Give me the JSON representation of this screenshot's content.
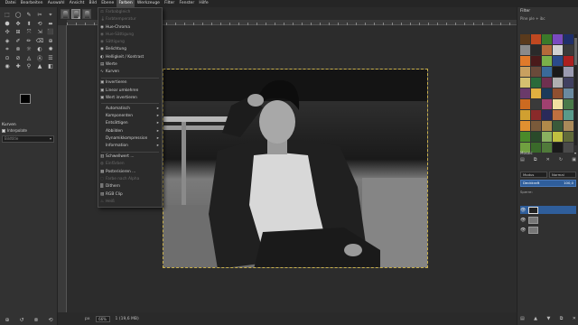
{
  "menubar": {
    "items": [
      "Datei",
      "Bearbeiten",
      "Auswahl",
      "Ansicht",
      "Bild",
      "Ebene",
      "Farben",
      "Werkzeuge",
      "Filter",
      "Fenster",
      "Hilfe"
    ],
    "active_index": 6
  },
  "tool_options": {
    "title": "Kurven",
    "checkbox_label": "Interpolate",
    "field_placeholder": "Bildtitle"
  },
  "colors_menu": {
    "items": [
      {
        "label": "Farbabgleich",
        "enabled": false,
        "icon": "balance-icon"
      },
      {
        "label": "Farbtemperatur",
        "enabled": false,
        "icon": "thermometer-icon"
      },
      {
        "label": "Hue-Chroma",
        "enabled": true,
        "icon": "circle-icon"
      },
      {
        "label": "Hue-Sättigung",
        "enabled": false,
        "icon": "circle-icon"
      },
      {
        "label": "Sättigung",
        "enabled": false,
        "icon": "circle-icon"
      },
      {
        "label": "Belichtung",
        "enabled": true,
        "icon": "circle-icon"
      },
      {
        "label": "Helligkeit / Kontrast",
        "enabled": true,
        "icon": "contrast-icon"
      },
      {
        "label": "Werte",
        "enabled": true,
        "icon": "levels-icon"
      },
      {
        "label": "Kurven",
        "enabled": true,
        "icon": "curves-icon"
      },
      {
        "label": "Invertieren",
        "enabled": true,
        "icon": "invert-icon"
      },
      {
        "label": "Linear umkehren",
        "enabled": true,
        "icon": "invert-icon"
      },
      {
        "label": "Wert invertieren",
        "enabled": true,
        "icon": "invert-icon"
      },
      {
        "label": "Automatisch",
        "enabled": true,
        "submenu": true
      },
      {
        "label": "Komponenten",
        "enabled": true,
        "submenu": true
      },
      {
        "label": "Entsättigen",
        "enabled": true,
        "submenu": true
      },
      {
        "label": "Abbilden",
        "enabled": true,
        "submenu": true
      },
      {
        "label": "Dynamikkompression",
        "enabled": true,
        "submenu": true
      },
      {
        "label": "Information",
        "enabled": true,
        "submenu": true
      },
      {
        "label": "Schwellwert ...",
        "enabled": true,
        "icon": "threshold-icon"
      },
      {
        "label": "Einfärben",
        "enabled": false,
        "icon": "colorize-icon"
      },
      {
        "label": "Posterisieren ...",
        "enabled": true,
        "icon": "posterize-icon"
      },
      {
        "label": "Farbe nach Alpha",
        "enabled": false,
        "icon": "alpha-icon"
      },
      {
        "label": "Dithern",
        "enabled": true,
        "icon": "dither-icon"
      },
      {
        "label": "RGB Clip",
        "enabled": true,
        "icon": "clip-icon"
      },
      {
        "label": "Heiß",
        "enabled": false,
        "icon": "hot-icon"
      }
    ]
  },
  "right_dock": {
    "title": "Filter",
    "filter_label": "Pine ple + ibc",
    "mode_label": "Mosaic",
    "pattern_colors": [
      "#5a3a1c",
      "#c04820",
      "#3b7a2a",
      "#7a4ac0",
      "#1f2f6a",
      "#8a8a8a",
      "#2a2a2a",
      "#b56a3a",
      "#d0d0d0",
      "#3a3a3a",
      "#e07a2a",
      "#4a1a1a",
      "#7ab04a",
      "#2a4a8a",
      "#aa2020",
      "#c8a060",
      "#6a4a3a",
      "#3a6a9a",
      "#1a1a1a",
      "#9a9ab0",
      "#d4c070",
      "#2a6a3a",
      "#703050",
      "#b0b0b0",
      "#404060",
      "#6a3a6a",
      "#e0b040",
      "#1a3a5a",
      "#905030",
      "#6a8aa0",
      "#cc6a20",
      "#3a3a3a",
      "#a04070",
      "#f0e0a0",
      "#4a7a4a",
      "#d0a030",
      "#8a2a2a",
      "#2a2a5a",
      "#c07040",
      "#5a9a8a",
      "#e09030",
      "#7a5a3a",
      "#b08a4a",
      "#3a5a3a",
      "#aa8a5a",
      "#4a8a2a",
      "#2a4a2a",
      "#8ab060",
      "#c0c040",
      "#606a3a",
      "#70a040",
      "#3a6a2a",
      "#507a3a",
      "#1a1a1a",
      "#4a4a4a"
    ]
  },
  "layers": {
    "mode_label": "Modus",
    "mode_value": "Normal",
    "opacity_label": "Deckkraft",
    "opacity_value": "100,0",
    "lock_label": "Sperre:",
    "rows": [
      {
        "selected": true,
        "dark": true
      },
      {
        "selected": false,
        "dark": false
      },
      {
        "selected": false,
        "dark": false
      }
    ]
  },
  "statusbar": {
    "unit": "px",
    "zoom": "66%",
    "info": "1 (19,6 MB)"
  }
}
